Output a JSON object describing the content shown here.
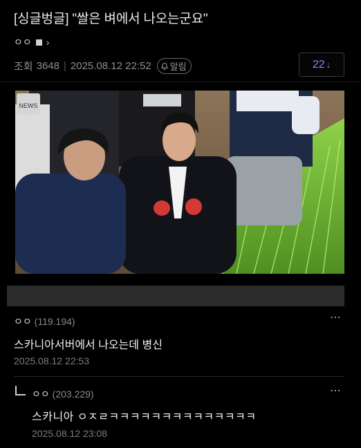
{
  "post": {
    "title": "[싱글벙글] \"쌀은 벼에서 나오는군요\"",
    "author": "ㅇㅇ",
    "views_label": "조회",
    "views": "3648",
    "datetime": "2025.08.12 22:52",
    "alarm_label": "알림",
    "comment_count": "22",
    "comment_sort_icon": "down-arrow"
  },
  "photo": {
    "broadcaster_logo": "NEWS"
  },
  "comments": [
    {
      "author": "ㅇㅇ",
      "score": "(119.194)",
      "text": "스카니아서버에서 나오는데 병신",
      "date": "2025.08.12 22:53",
      "more": "⋯"
    },
    {
      "author": "ㅇㅇ",
      "score": "(203.229)",
      "text": "스카니아 ㅇㅈㄹㅋㅋㅋㅋㅋㅋㅋㅋㅋㅋㅋㅋㅋㅋ",
      "date": "2025.08.12 23:08",
      "more": "⋯"
    }
  ]
}
